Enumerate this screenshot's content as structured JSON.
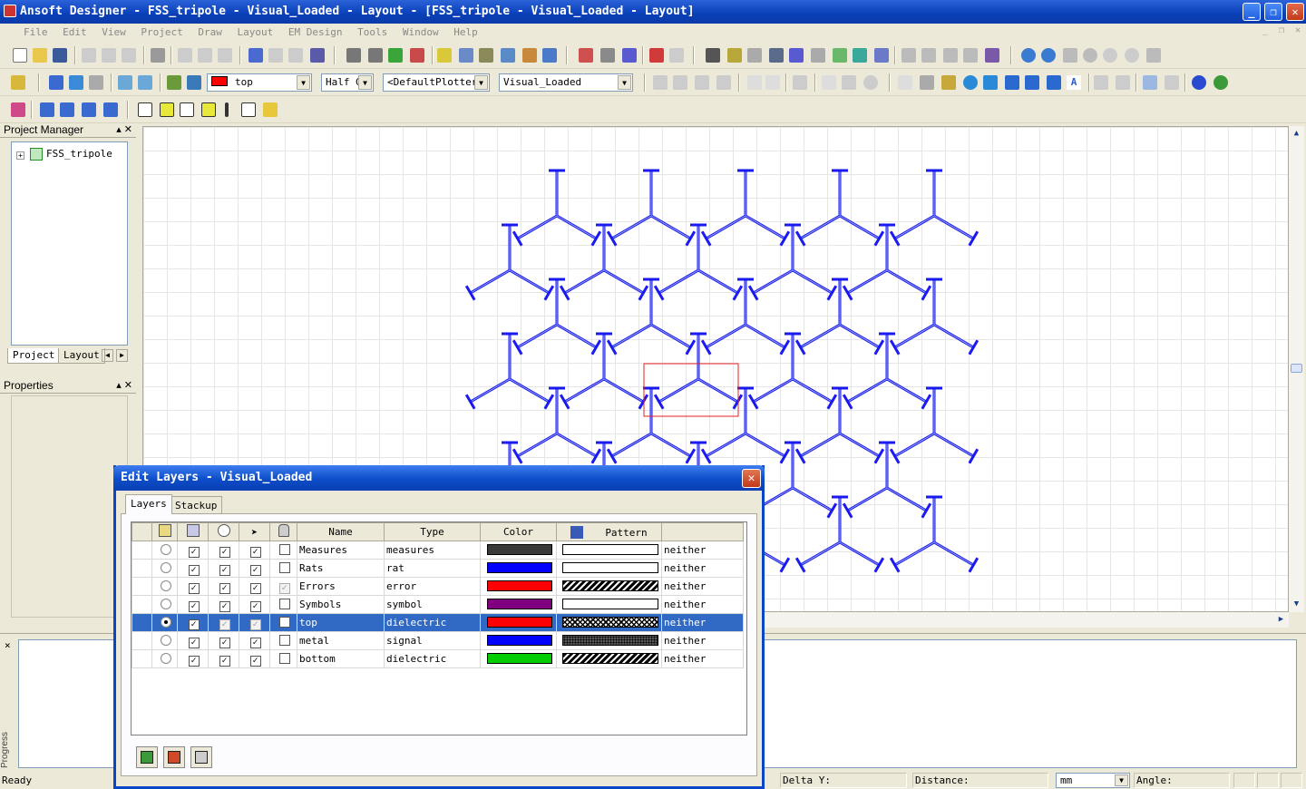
{
  "window": {
    "title": "Ansoft Designer - FSS_tripole - Visual_Loaded - Layout - [FSS_tripole - Visual_Loaded - Layout]"
  },
  "menu": [
    "File",
    "Edit",
    "View",
    "Project",
    "Draw",
    "Layout",
    "EM Design",
    "Tools",
    "Window",
    "Help"
  ],
  "toolbar": {
    "layer_combo": "top",
    "snap_combo": "Half G",
    "plotter_combo": "<DefaultPlotter>",
    "design_combo": "Visual_Loaded"
  },
  "project_manager": {
    "title": "Project Manager",
    "tree_root": "FSS_tripole",
    "tab_project": "Project",
    "tab_layout": "Layout"
  },
  "properties": {
    "title": "Properties"
  },
  "progress": {
    "label": "Progress",
    "close": "×"
  },
  "status": {
    "ready": "Ready",
    "delta_y": "Delta Y:",
    "distance": "Distance:",
    "units": "mm",
    "angle": "Angle:"
  },
  "dialog": {
    "title": "Edit Layers - Visual_Loaded",
    "tabs": [
      "Layers",
      "Stackup"
    ],
    "columns": {
      "name": "Name",
      "type": "Type",
      "color": "Color",
      "pattern": "Pattern"
    },
    "rows": [
      {
        "name": "Measures",
        "type": "measures",
        "color": "#3a3a3a",
        "pattern": "solid-white",
        "extra": "neither",
        "selected": false,
        "lock": false
      },
      {
        "name": "Rats",
        "type": "rat",
        "color": "#0000ff",
        "pattern": "solid-white",
        "extra": "neither",
        "selected": false,
        "lock": false
      },
      {
        "name": "Errors",
        "type": "error",
        "color": "#ff0000",
        "pattern": "hatch",
        "extra": "neither",
        "selected": false,
        "lock": true
      },
      {
        "name": "Symbols",
        "type": "symbol",
        "color": "#800080",
        "pattern": "solid-white",
        "extra": "neither",
        "selected": false,
        "lock": false
      },
      {
        "name": "top",
        "type": "dielectric",
        "color": "#ff0000",
        "pattern": "cross",
        "extra": "neither",
        "selected": true,
        "lock": false
      },
      {
        "name": "metal",
        "type": "signal",
        "color": "#0000ff",
        "pattern": "dots",
        "extra": "neither",
        "selected": false,
        "lock": false
      },
      {
        "name": "bottom",
        "type": "dielectric",
        "color": "#00cc00",
        "pattern": "hatch",
        "extra": "neither",
        "selected": false,
        "lock": false
      }
    ]
  }
}
